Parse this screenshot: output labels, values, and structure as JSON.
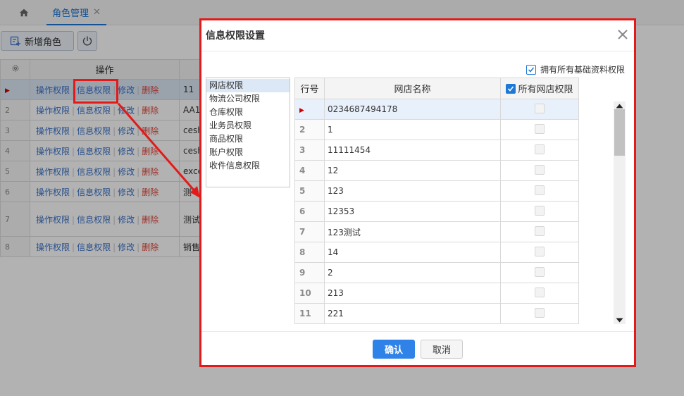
{
  "tabs": {
    "home_icon": "home-icon",
    "active_tab": "角色管理",
    "close_glyph": "✕"
  },
  "toolbar": {
    "add_role_label": "新增角色",
    "power_icon": "power-icon"
  },
  "role_grid": {
    "header_ops": "操作",
    "ops_labels": {
      "op_perm": "操作权限",
      "info_perm": "信息权限",
      "edit": "修改",
      "del": "删除"
    },
    "rows": [
      {
        "no": "▶",
        "name": "11"
      },
      {
        "no": "2",
        "name": "AA1"
      },
      {
        "no": "3",
        "name": "cesh"
      },
      {
        "no": "4",
        "name": "cesh"
      },
      {
        "no": "5",
        "name": "exce"
      },
      {
        "no": "6",
        "name": "测"
      },
      {
        "no": "7",
        "name": "测试"
      },
      {
        "no": "8",
        "name": "销售"
      }
    ]
  },
  "dialog": {
    "title": "信息权限设置",
    "all_basic_label": "拥有所有基础资料权限",
    "all_basic_checked": true,
    "categories": [
      "网店权限",
      "物流公司权限",
      "仓库权限",
      "业务员权限",
      "商品权限",
      "账户权限",
      "收件信息权限"
    ],
    "active_category": "网店权限",
    "grid": {
      "col_rownum": "行号",
      "col_name": "网店名称",
      "col_all": "所有网店权限",
      "all_checked": true,
      "rows": [
        {
          "no": "▶",
          "name": "0234687494178"
        },
        {
          "no": "2",
          "name": "1"
        },
        {
          "no": "3",
          "name": "11111454"
        },
        {
          "no": "4",
          "name": "12"
        },
        {
          "no": "5",
          "name": "123"
        },
        {
          "no": "6",
          "name": "12353"
        },
        {
          "no": "7",
          "name": "123测试"
        },
        {
          "no": "8",
          "name": "14"
        },
        {
          "no": "9",
          "name": "2"
        },
        {
          "no": "10",
          "name": "213"
        },
        {
          "no": "11",
          "name": "221"
        }
      ]
    },
    "confirm_label": "确认",
    "cancel_label": "取消"
  },
  "colors": {
    "accent": "#1e78d7",
    "primary_button": "#2f83e8",
    "annotation_red": "#e41919",
    "delete_red": "#e0453a"
  }
}
